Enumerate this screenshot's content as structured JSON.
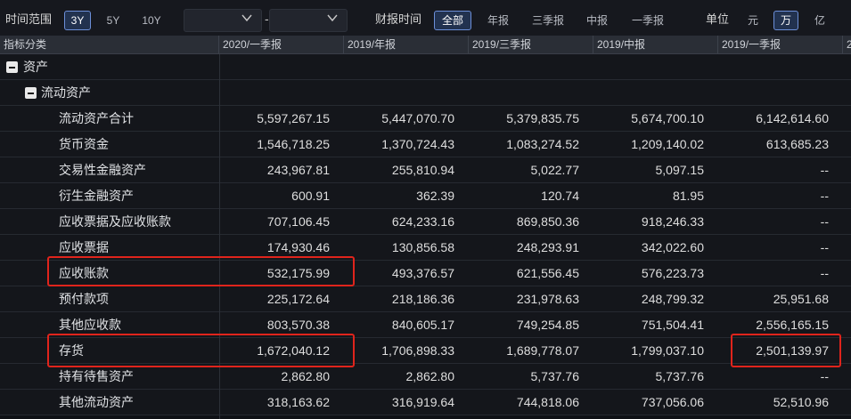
{
  "toolbar": {
    "time_range_label": "时间范围",
    "range_buttons": [
      "3Y",
      "5Y",
      "10Y"
    ],
    "range_selected": "3Y",
    "start_date": "",
    "end_date": "",
    "date_separator": "-",
    "report_time_label": "财报时间",
    "report_buttons": [
      "全部",
      "年报",
      "三季报",
      "中报",
      "一季报"
    ],
    "report_selected": "全部",
    "unit_label": "单位",
    "unit_buttons": [
      "元",
      "万",
      "亿"
    ],
    "unit_selected": "万"
  },
  "table": {
    "header_first": "指标分类",
    "columns": [
      "2020/一季报",
      "2019/年报",
      "2019/三季报",
      "2019/中报",
      "2019/一季报",
      "2"
    ],
    "group_1": "资产",
    "group_2": "流动资产",
    "rows": [
      {
        "label": "流动资产合计",
        "values": [
          "5,597,267.15",
          "5,447,070.70",
          "5,379,835.75",
          "5,674,700.10",
          "6,142,614.60"
        ]
      },
      {
        "label": "货币资金",
        "values": [
          "1,546,718.25",
          "1,370,724.43",
          "1,083,274.52",
          "1,209,140.02",
          "613,685.23"
        ]
      },
      {
        "label": "交易性金融资产",
        "values": [
          "243,967.81",
          "255,810.94",
          "5,022.77",
          "5,097.15",
          "--"
        ]
      },
      {
        "label": "衍生金融资产",
        "values": [
          "600.91",
          "362.39",
          "120.74",
          "81.95",
          "--"
        ]
      },
      {
        "label": "应收票据及应收账款",
        "values": [
          "707,106.45",
          "624,233.16",
          "869,850.36",
          "918,246.33",
          "--"
        ]
      },
      {
        "label": "应收票据",
        "values": [
          "174,930.46",
          "130,856.58",
          "248,293.91",
          "342,022.60",
          "--"
        ]
      },
      {
        "label": "应收账款",
        "values": [
          "532,175.99",
          "493,376.57",
          "621,556.45",
          "576,223.73",
          "--"
        ]
      },
      {
        "label": "预付款项",
        "values": [
          "225,172.64",
          "218,186.36",
          "231,978.63",
          "248,799.32",
          "25,951.68"
        ]
      },
      {
        "label": "其他应收款",
        "values": [
          "803,570.38",
          "840,605.17",
          "749,254.85",
          "751,504.41",
          "2,556,165.15"
        ]
      },
      {
        "label": "存货",
        "values": [
          "1,672,040.12",
          "1,706,898.33",
          "1,689,778.07",
          "1,799,037.10",
          "2,501,139.97"
        ]
      },
      {
        "label": "持有待售资产",
        "values": [
          "2,862.80",
          "2,862.80",
          "5,737.76",
          "5,737.76",
          "--"
        ]
      },
      {
        "label": "其他流动资产",
        "values": [
          "318,163.62",
          "316,919.64",
          "744,818.06",
          "737,056.06",
          "52,510.96"
        ]
      }
    ]
  },
  "colors": {
    "highlight": "#e0241c",
    "accent": "#6c8fd8",
    "background": "#14161b"
  }
}
